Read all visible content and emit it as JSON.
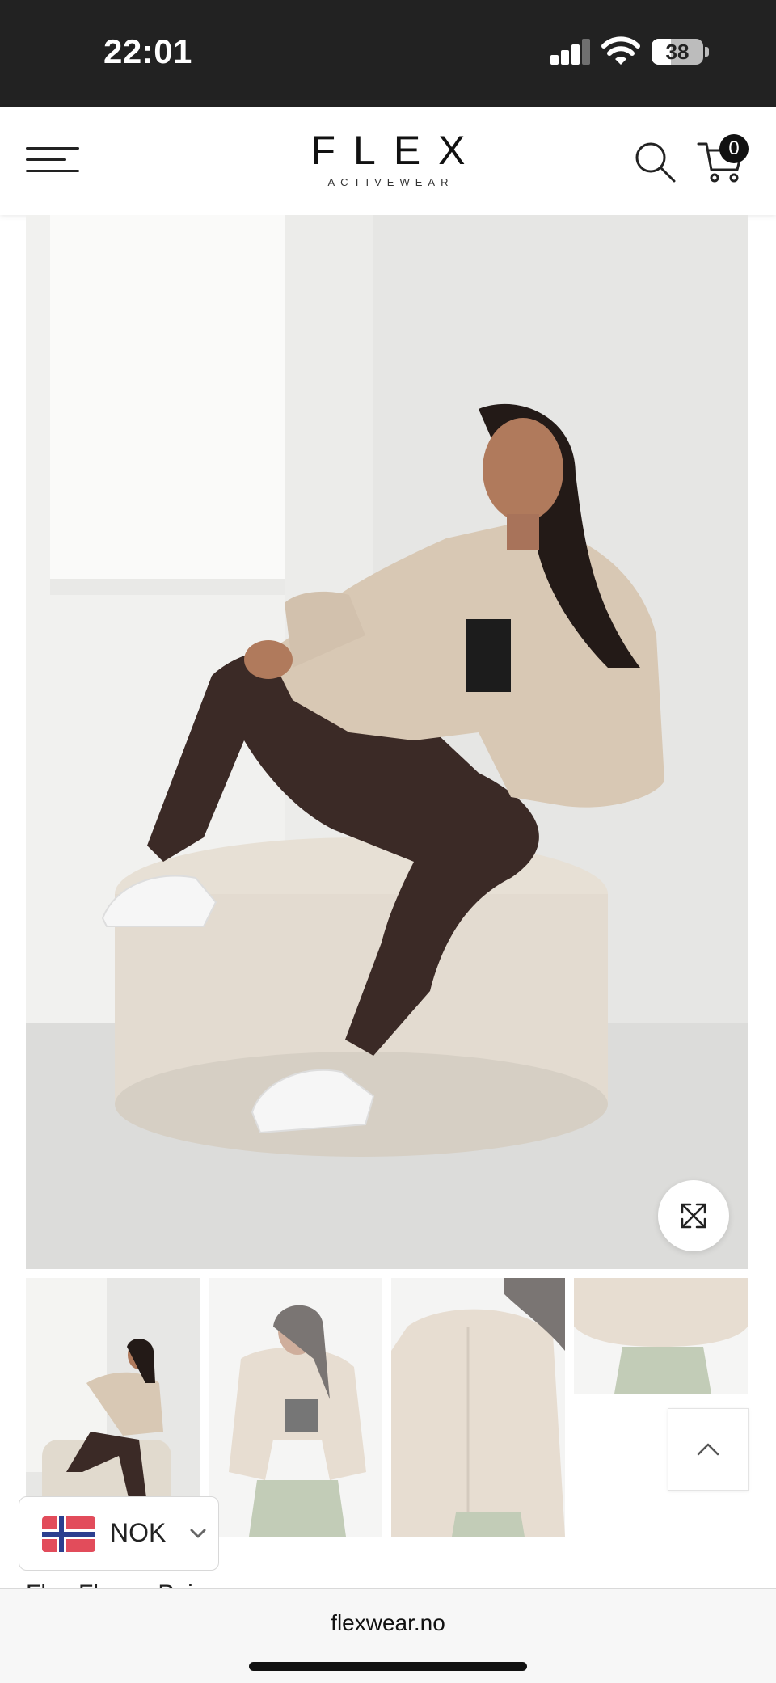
{
  "status_bar": {
    "time": "22:01",
    "battery_percent": 38,
    "icons": [
      "cellular-signal-icon",
      "wifi-icon",
      "battery-icon"
    ]
  },
  "header": {
    "brand_name": "FLEX",
    "brand_subtitle": "ACTIVEWEAR",
    "cart_count": "0",
    "icons": [
      "hamburger-menu-icon",
      "search-icon",
      "shopping-cart-icon"
    ]
  },
  "gallery": {
    "main_image": "model-in-beige-fleece-jacket-brown-leggings",
    "thumbnails": [
      "model-seated-beige-jacket-brown-leggings",
      "model-standing-beige-jacket-green-leggings",
      "closeup-jacket-zipper",
      "closeup-jacket-hem-green-leggings"
    ]
  },
  "currency": {
    "code": "NOK",
    "flag": "norway-flag"
  },
  "product": {
    "title_fragment": "Flex Fleece Pei"
  },
  "browser": {
    "url": "flexwear.no"
  },
  "colors": {
    "status_bar_bg": "#222222",
    "accent": "#111111",
    "jacket_beige": "#d8c8b4",
    "leggings_brown": "#3b2a26",
    "leggings_green": "#9aab88"
  }
}
